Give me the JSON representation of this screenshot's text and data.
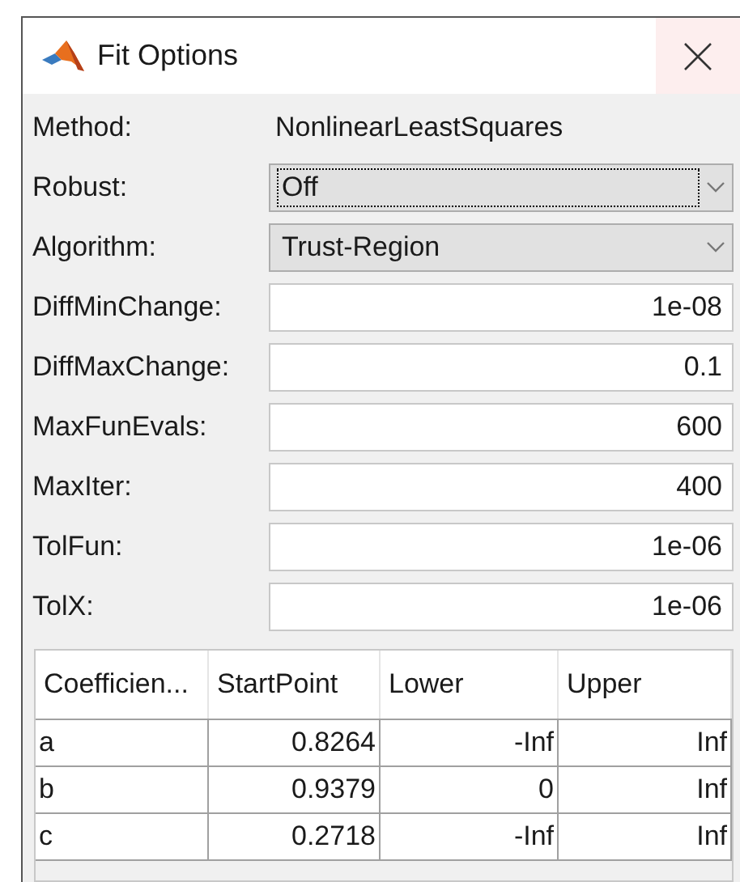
{
  "window": {
    "title": "Fit Options"
  },
  "options": [
    {
      "label": "Method:",
      "kind": "text",
      "value": "NonlinearLeastSquares"
    },
    {
      "label": "Robust:",
      "kind": "dropdown",
      "value": "Off",
      "focused": true
    },
    {
      "label": "Algorithm:",
      "kind": "dropdown",
      "value": "Trust-Region",
      "focused": false
    },
    {
      "label": "DiffMinChange:",
      "kind": "input",
      "value": "1e-08"
    },
    {
      "label": "DiffMaxChange:",
      "kind": "input",
      "value": "0.1"
    },
    {
      "label": "MaxFunEvals:",
      "kind": "input",
      "value": "600"
    },
    {
      "label": "MaxIter:",
      "kind": "input",
      "value": "400"
    },
    {
      "label": "TolFun:",
      "kind": "input",
      "value": "1e-06"
    },
    {
      "label": "TolX:",
      "kind": "input",
      "value": "1e-06"
    }
  ],
  "table": {
    "columns": [
      "Coefficien...",
      "StartPoint",
      "Lower",
      "Upper"
    ],
    "rows": [
      [
        "a",
        "0.8264",
        "-Inf",
        "Inf"
      ],
      [
        "b",
        "0.9379",
        "0",
        "Inf"
      ],
      [
        "c",
        "0.2718",
        "-Inf",
        "Inf"
      ]
    ]
  }
}
